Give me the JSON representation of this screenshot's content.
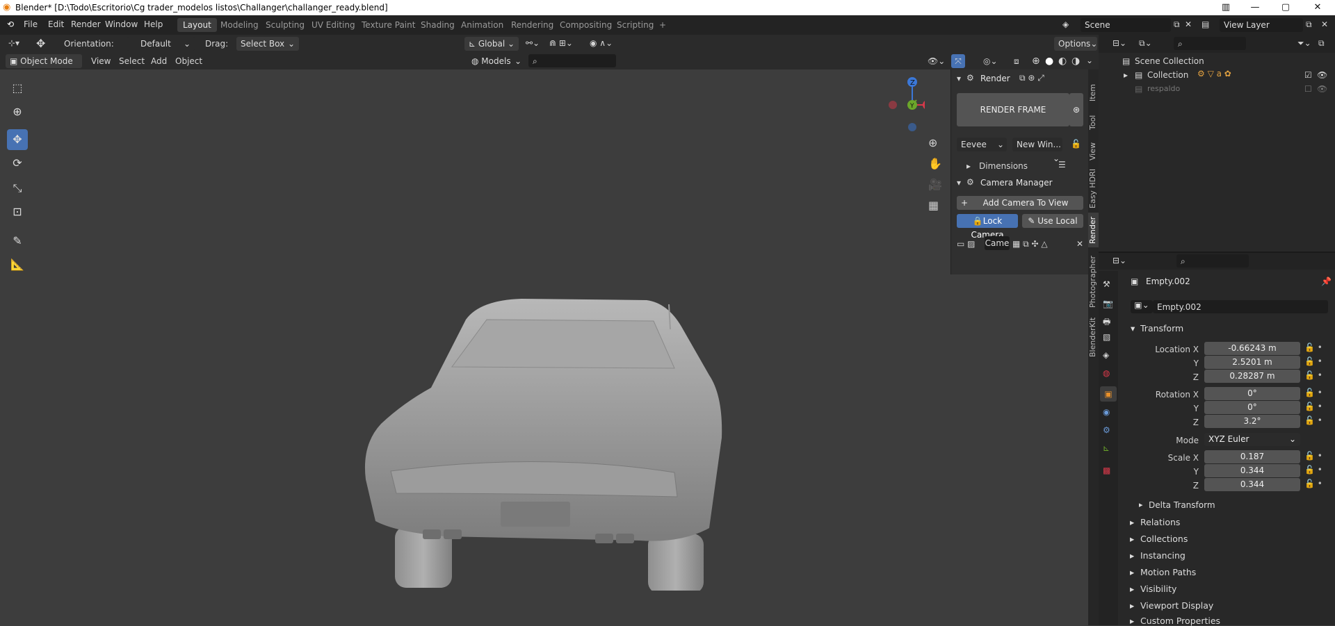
{
  "window": {
    "title": "Blender* [D:\\Todo\\Escritorio\\Cg trader_modelos listos\\Challanger\\challanger_ready.blend]",
    "min": "—",
    "max": "▢",
    "close": "✕"
  },
  "menu": [
    "File",
    "Edit",
    "Render",
    "Window",
    "Help"
  ],
  "workspaces": [
    "Layout",
    "Modeling",
    "Sculpting",
    "UV Editing",
    "Texture Paint",
    "Shading",
    "Animation",
    "Rendering",
    "Compositing",
    "Scripting",
    "+"
  ],
  "scene": {
    "name": "Scene",
    "view_layer": "View Layer"
  },
  "tool_header": {
    "orientation_label": "Orientation:",
    "orientation_value": "Default",
    "drag_label": "Drag:",
    "drag_value": "Select Box",
    "transform": "Global",
    "options": "Options"
  },
  "viewport_header": {
    "mode": "Object Mode",
    "view": "View",
    "select": "Select",
    "add": "Add",
    "object": "Object",
    "collection": "Models"
  },
  "gizmo": {
    "z": "Z",
    "y": "Y",
    "x": "X"
  },
  "render_panel": {
    "title": "Render",
    "render_frame": "RENDER FRAME",
    "engine": "Eevee",
    "window": "New Win...",
    "dimensions": "Dimensions",
    "camera_manager": "Camera Manager",
    "add_camera": "Add Camera To View",
    "lock_camera": "Lock Camera",
    "use_local": "Use Local",
    "cam_field": "Came"
  },
  "sidebar_tabs": [
    "Item",
    "Tool",
    "View",
    "Easy HDRI",
    "Render",
    "Photographer",
    "BlenderKit"
  ],
  "outliner": {
    "scene_collection": "Scene Collection",
    "collection": "Collection",
    "respaldo": "respaldo"
  },
  "properties": {
    "object_name": "Empty.002",
    "data_name": "Empty.002",
    "transform_title": "Transform",
    "location": {
      "label_x": "Location X",
      "label_y": "Y",
      "label_z": "Z",
      "x": "-0.66243 m",
      "y": "2.5201 m",
      "z": "0.28287 m"
    },
    "rotation": {
      "label_x": "Rotation X",
      "label_y": "Y",
      "label_z": "Z",
      "x": "0°",
      "y": "0°",
      "z": "3.2°"
    },
    "mode_label": "Mode",
    "mode": "XYZ Euler",
    "scale": {
      "label_x": "Scale X",
      "label_y": "Y",
      "label_z": "Z",
      "x": "0.187",
      "y": "0.344",
      "z": "0.344"
    },
    "sections": [
      "Delta Transform",
      "Relations",
      "Collections",
      "Instancing",
      "Motion Paths",
      "Visibility",
      "Viewport Display",
      "Custom Properties"
    ]
  }
}
